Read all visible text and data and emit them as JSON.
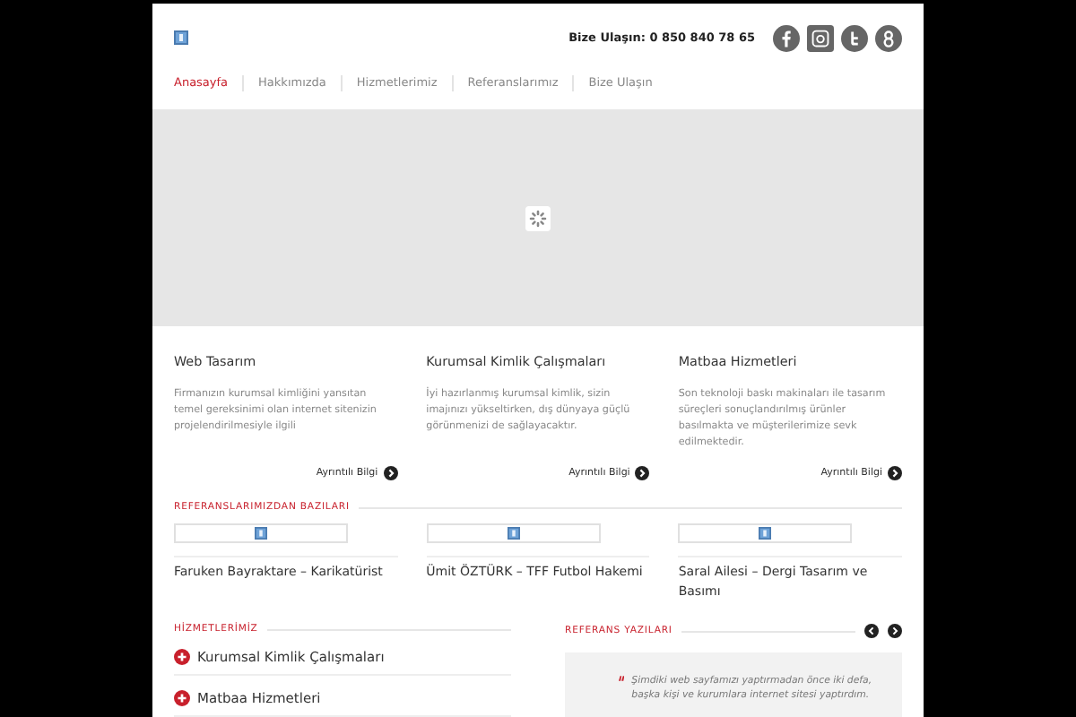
{
  "header": {
    "contact": "Bize Ulaşın: 0 850 840 78 65",
    "social": [
      {
        "kind": "facebook"
      },
      {
        "kind": "instagram"
      },
      {
        "kind": "twitter"
      },
      {
        "kind": "google"
      }
    ]
  },
  "nav": [
    {
      "label": "Anasayfa",
      "selected": true
    },
    {
      "label": "Hakkımızda",
      "selected": false
    },
    {
      "label": "Hizmetlerimiz",
      "selected": false
    },
    {
      "label": "Referanslarımız",
      "selected": false
    },
    {
      "label": "Bize Ulaşın",
      "selected": false
    }
  ],
  "services": [
    {
      "title": "Web Tasarım",
      "text": "Firmanızın kurumsal kimliğini yansıtan temel gereksinimi olan internet sitenizin projelendirilmesiyle ilgili",
      "link": "Ayrıntılı Bilgi"
    },
    {
      "title": "Kurumsal Kimlik Çalışmaları",
      "text": "İyi hazırlanmış kurumsal kimlik, sizin imajınızı yükseltirken, dış dünyaya güçlü görünmenizi de sağlayacaktır.",
      "link": "Ayrıntılı Bilgi"
    },
    {
      "title": "Matbaa Hizmetleri",
      "text": "Son teknoloji baskı makinaları ile tasarım süreçleri sonuçlandırılmış ürünler basılmakta ve müşterilerimize sevk edilmektedir.",
      "link": "Ayrıntılı Bilgi"
    }
  ],
  "references": {
    "heading": "REFERANSLARIMIZDAN BAZILARI",
    "items": [
      {
        "title": "Faruken Bayraktare – Karikatürist"
      },
      {
        "title": "Ümit ÖZTÜRK – TFF Futbol Hakemi"
      },
      {
        "title": "Saral Ailesi – Dergi Tasarım ve Basımı"
      }
    ]
  },
  "our_services": {
    "heading": "HİZMETLERİMİZ",
    "items": [
      "Kurumsal Kimlik Çalışmaları",
      "Matbaa Hizmetleri"
    ]
  },
  "testimonials": {
    "heading": "REFERANS YAZILARI",
    "quote": "Şimdiki web sayfamızı yaptırmadan önce iki defa, başka kişi ve kurumlara internet sitesi yaptırdım."
  }
}
